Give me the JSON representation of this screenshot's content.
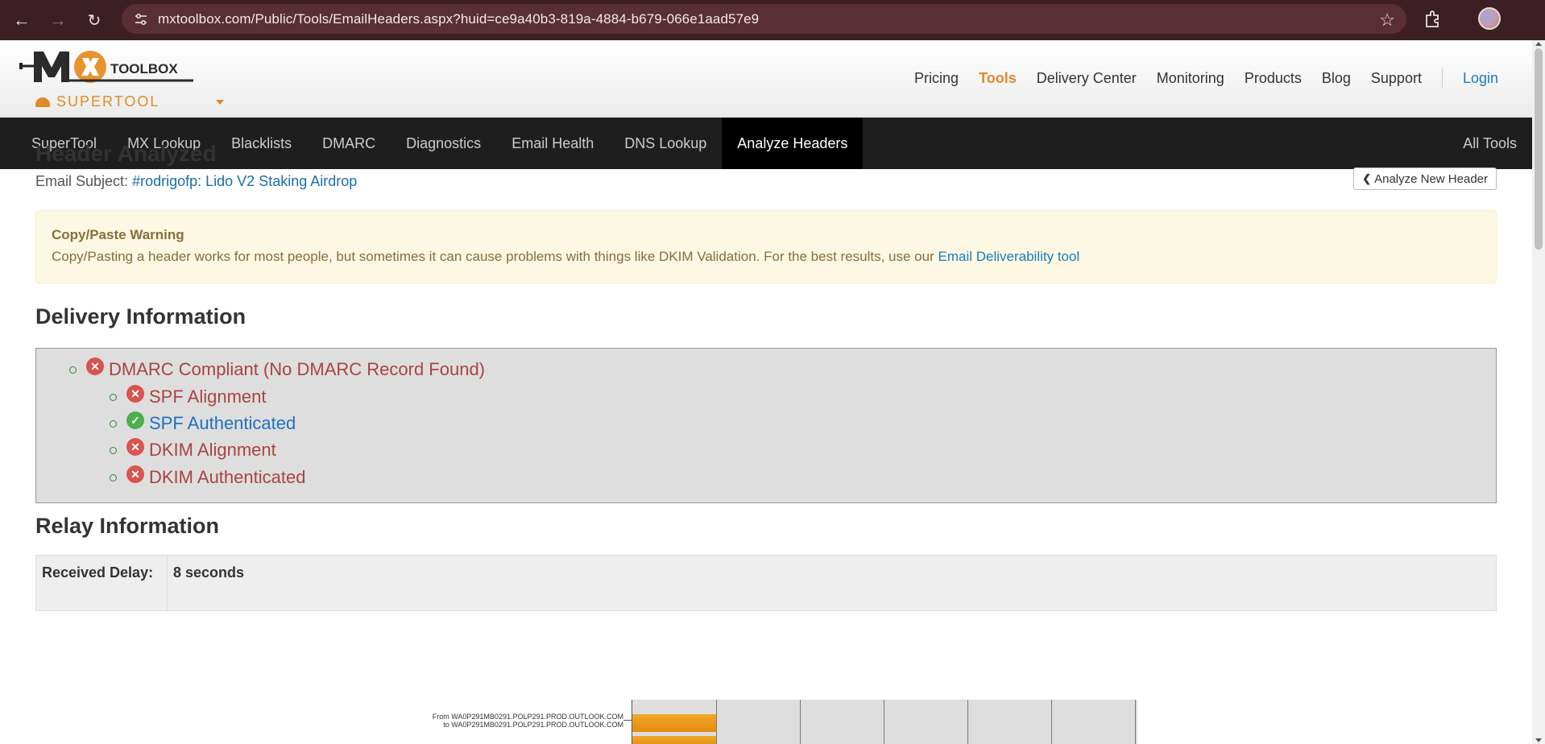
{
  "browser": {
    "url": "mxtoolbox.com/Public/Tools/EmailHeaders.aspx?huid=ce9a40b3-819a-4884-b679-066e1aad57e9"
  },
  "site": {
    "logo_text": "TOOLBOX",
    "supertool_label": "SUPERTOOL",
    "top_nav": [
      "Pricing",
      "Tools",
      "Delivery Center",
      "Monitoring",
      "Products",
      "Blog",
      "Support"
    ],
    "login_label": "Login"
  },
  "tool_nav": {
    "items": [
      "SuperTool",
      "MX Lookup",
      "Blacklists",
      "DMARC",
      "Diagnostics",
      "Email Health",
      "DNS Lookup",
      "Analyze Headers"
    ],
    "active": "Analyze Headers",
    "all_tools": "All Tools"
  },
  "main": {
    "title": "Header Analyzed",
    "subject_label": "Email Subject:",
    "subject_value": "#rodrigofp: Lido V2 Staking Airdrop",
    "analyze_new_label": "Analyze New Header",
    "warning": {
      "title": "Copy/Paste Warning",
      "body": "Copy/Pasting a header works for most people, but sometimes it can cause problems with things like DKIM Validation. For the best results, use our",
      "link": "Email Deliverability tool"
    },
    "delivery": {
      "heading": "Delivery Information",
      "items": [
        {
          "label": "DMARC Compliant (No DMARC Record Found)",
          "status": "fail"
        },
        {
          "label": "SPF Alignment",
          "status": "fail"
        },
        {
          "label": "SPF Authenticated",
          "status": "pass"
        },
        {
          "label": "DKIM Alignment",
          "status": "fail"
        },
        {
          "label": "DKIM Authenticated",
          "status": "fail"
        }
      ]
    },
    "relay": {
      "heading": "Relay Information",
      "received_delay_label": "Received Delay:",
      "received_delay_value": "8 seconds",
      "hop_from": "From WA0P291MB0291.POLP291.PROD.OUTLOOK.COM",
      "hop_to": "to WA0P291MB0291.POLP291.PROD.OUTLOOK.COM"
    }
  },
  "colors": {
    "brand_orange": "#e08a29",
    "nav_dark": "#1e1e1e",
    "fail_red": "#d9534f",
    "pass_green": "#4cae4c",
    "link_blue": "#1a7cc1",
    "warning_bg": "#fcf8e3"
  }
}
